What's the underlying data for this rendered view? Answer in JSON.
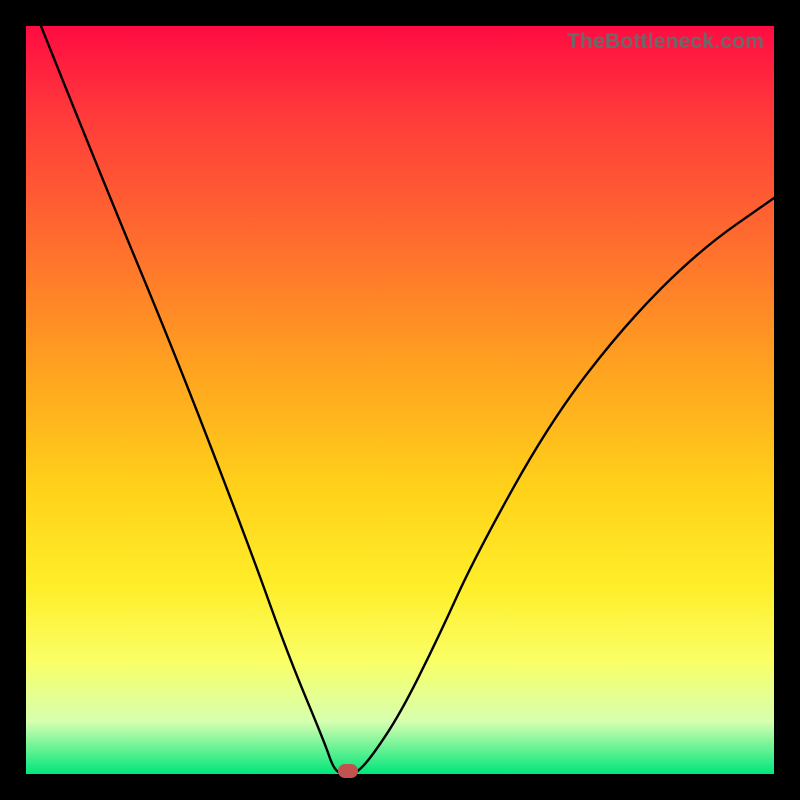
{
  "watermark": "TheBottleneck.com",
  "chart_data": {
    "type": "line",
    "title": "",
    "xlabel": "",
    "ylabel": "",
    "xlim": [
      0,
      100
    ],
    "ylim": [
      0,
      100
    ],
    "grid": false,
    "legend": null,
    "series": [
      {
        "name": "bottleneck-curve",
        "x": [
          2,
          10,
          20,
          30,
          35,
          40,
          41,
          42,
          43,
          44,
          46,
          50,
          55,
          60,
          70,
          80,
          90,
          100
        ],
        "values": [
          100,
          80,
          56,
          30,
          16,
          4,
          1,
          0,
          0,
          0,
          2,
          8,
          18,
          29,
          47,
          60,
          70,
          77
        ]
      }
    ],
    "annotations": [
      {
        "name": "optimal-marker",
        "x": 43,
        "y": 0,
        "color": "#c1524f"
      }
    ],
    "colors": {
      "gradient_top": "#ff0b42",
      "gradient_bottom": "#00e67a",
      "curve": "#000000",
      "marker": "#c1524f",
      "frame": "#000000"
    }
  }
}
